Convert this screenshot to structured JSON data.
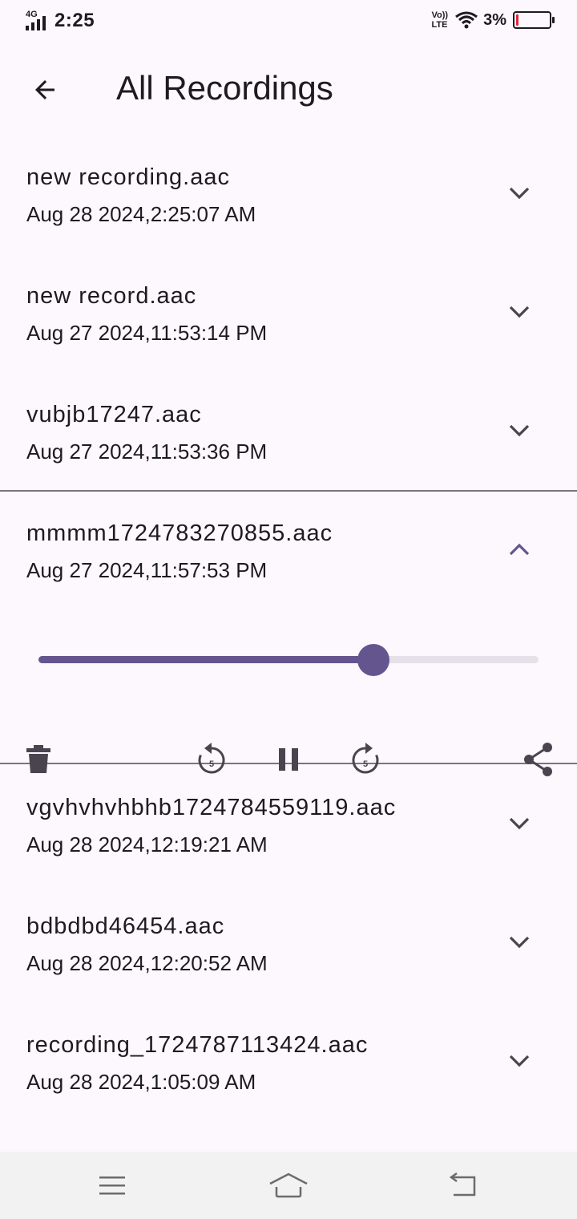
{
  "status_bar": {
    "network_type": "4G",
    "time": "2:25",
    "volte_top": "Vo))",
    "volte_bottom": "LTE",
    "battery_percent": "3%",
    "battery_level": 0.03,
    "battery_color": "#e0243a"
  },
  "app_bar": {
    "back_icon": "arrow-left-icon",
    "title": "All Recordings"
  },
  "recordings_before": [
    {
      "name": "new recording.aac",
      "date": "Aug 28 2024,2:25:07 AM"
    },
    {
      "name": "new record.aac",
      "date": "Aug 27 2024,11:53:14 PM"
    },
    {
      "name": "vubjb17247.aac",
      "date": "Aug 27 2024,11:53:36 PM"
    }
  ],
  "expanded_recording": {
    "name": "mmmm1724783270855.aac",
    "date": "Aug 27 2024,11:57:53 PM",
    "progress": 0.67,
    "controls": {
      "delete_icon": "trash-icon",
      "rewind_icon": "replay-5-icon",
      "rewind_seconds": "5",
      "pause_icon": "pause-icon",
      "forward_icon": "forward-5-icon",
      "forward_seconds": "5",
      "share_icon": "share-icon"
    }
  },
  "recordings_after": [
    {
      "name": "vgvhvhvhbhb1724784559119.aac",
      "date": "Aug 28 2024,12:19:21 AM"
    },
    {
      "name": "bdbdbd46454.aac",
      "date": "Aug 28 2024,12:20:52 AM"
    },
    {
      "name": "recording_1724787113424.aac",
      "date": "Aug 28 2024,1:05:09 AM"
    }
  ],
  "colors": {
    "accent": "#65558f",
    "background": "#fdf7fe",
    "divider": "#79747e"
  },
  "nav_bar": {
    "menu_icon": "menu-icon",
    "home_icon": "home-icon",
    "back_icon": "back-icon"
  }
}
